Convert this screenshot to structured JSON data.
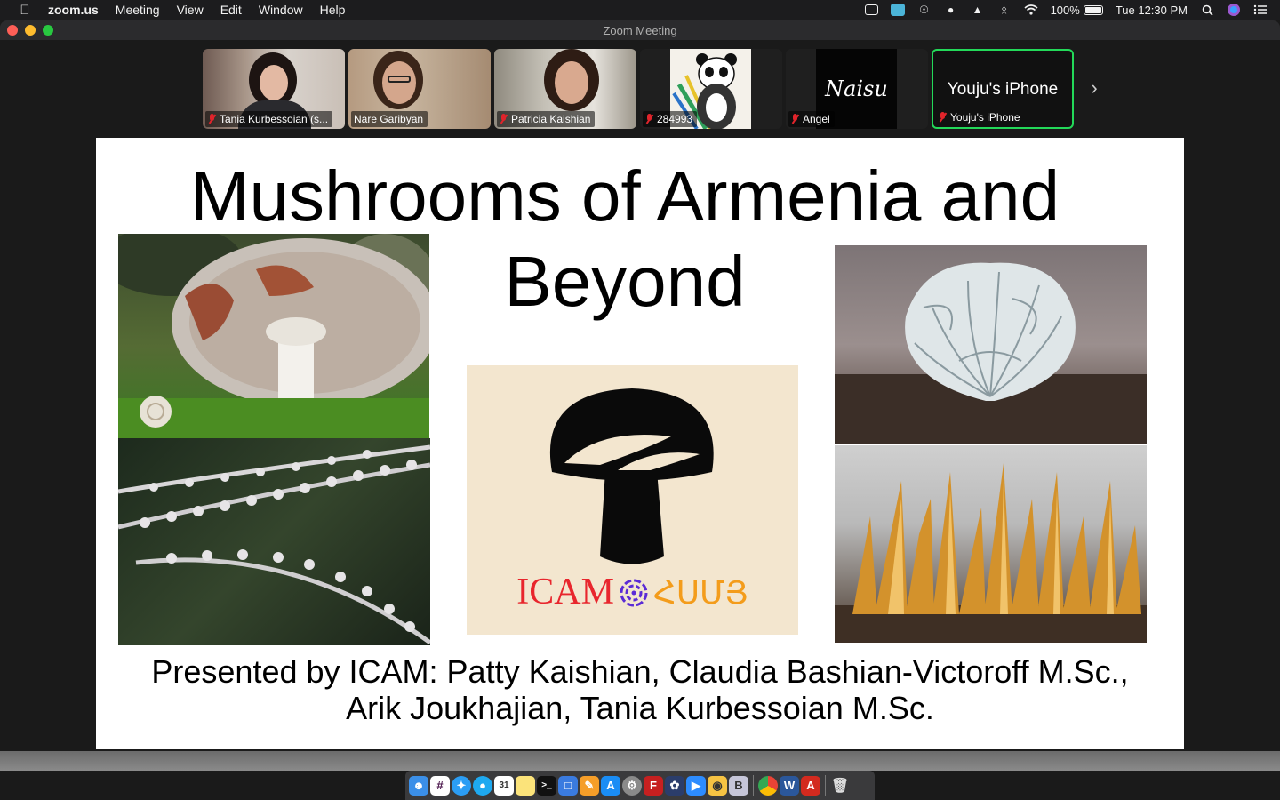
{
  "menubar": {
    "apple_icon": "apple-logo-icon",
    "app_name": "zoom.us",
    "menus": [
      "Meeting",
      "View",
      "Edit",
      "Window",
      "Help"
    ],
    "battery": "100%",
    "clock": "Tue 12:30 PM"
  },
  "window": {
    "title": "Zoom Meeting"
  },
  "participants": [
    {
      "name": "Tania Kurbessoian (s...",
      "muted": true
    },
    {
      "name": "Nare Garibyan",
      "muted": false
    },
    {
      "name": "Patricia Kaishian",
      "muted": true
    },
    {
      "name": "284993",
      "muted": true
    },
    {
      "name": "Angel",
      "muted": true,
      "avatar_text": "Naisu"
    },
    {
      "name": "Youju's iPhone",
      "muted": true,
      "video_off_label": "Youju's iPhone",
      "active_speaker": true
    }
  ],
  "slide": {
    "title": "Mushrooms of Armenia and Beyond",
    "logo": {
      "text_left": "ICAM",
      "text_right": "ՀՍՄՅ",
      "colors": {
        "left": "#e8262d",
        "swirl": "#5b2bd6",
        "right": "#f39c1b",
        "background": "#f3e6cf"
      }
    },
    "presenters": "Presented by ICAM: Patty Kaishian, Claudia Bashian-Victoroff M.Sc., Arik Joukhajian, Tania Kurbessoian M.Sc."
  },
  "dock": {
    "apps": [
      "finder-icon",
      "slack-icon",
      "safari-icon",
      "messages-icon",
      "calendar-icon",
      "notes-icon",
      "terminal-icon",
      "keynote-icon",
      "pages-icon",
      "app-store-icon",
      "system-preferences-icon",
      "filezilla-icon",
      "photos-icon",
      "zoom-icon",
      "cyberduck-icon",
      "bbedit-icon",
      "chrome-icon",
      "word-icon",
      "acrobat-icon",
      "trash-icon"
    ]
  }
}
